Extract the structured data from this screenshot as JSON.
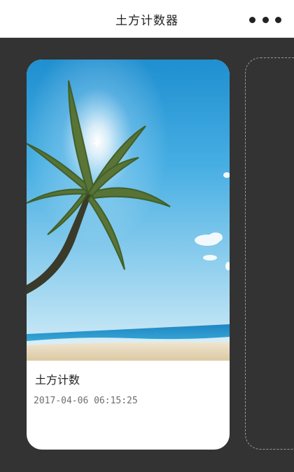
{
  "header": {
    "title": "土方计数器",
    "more_icon": "more-dots-icon"
  },
  "cards": [
    {
      "image_icon": "beach-palm-photo",
      "title": "土方计数",
      "date": "2017-04-06 06:15:25"
    }
  ],
  "colors": {
    "page_background": "#333333",
    "navbar_background": "#ffffff",
    "card_background": "#ffffff",
    "title_text": "#222222",
    "date_text": "#6e6e6e"
  }
}
